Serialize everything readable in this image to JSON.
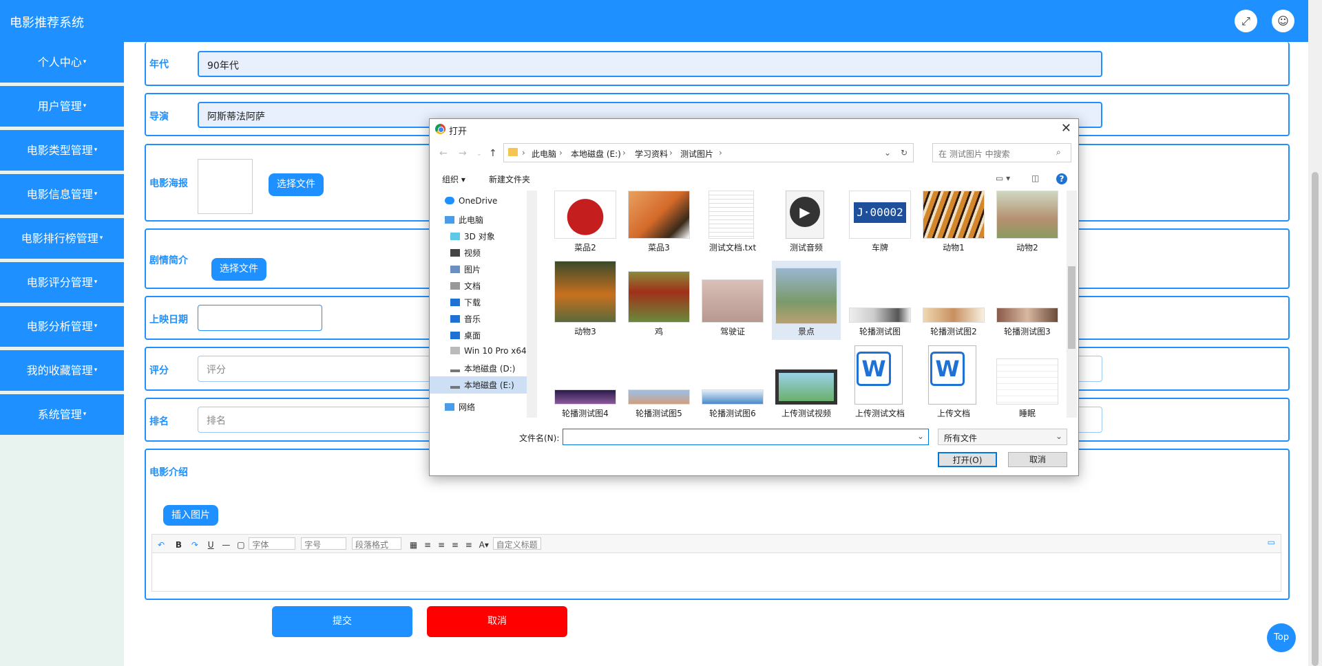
{
  "app": {
    "title": "电影推荐系统",
    "fullscreen_icon": "expand-icon",
    "user_icon": "user-icon",
    "top_button": "Top"
  },
  "sidebar": {
    "items": [
      {
        "label": "个人中心"
      },
      {
        "label": "用户管理"
      },
      {
        "label": "电影类型管理"
      },
      {
        "label": "电影信息管理"
      },
      {
        "label": "电影排行榜管理"
      },
      {
        "label": "电影评分管理"
      },
      {
        "label": "电影分析管理"
      },
      {
        "label": "我的收藏管理"
      },
      {
        "label": "系统管理"
      }
    ],
    "caret": "▾"
  },
  "form": {
    "year_label": "年代",
    "year_value": "90年代",
    "director_label": "导演",
    "director_value": "阿斯蒂法阿萨",
    "poster_label": "电影海报",
    "poster_button": "选择文件",
    "synopsis_label": "剧情简介",
    "synopsis_button": "选择文件",
    "release_label": "上映日期",
    "score_label": "评分",
    "score_placeholder": "评分",
    "rank_label": "排名",
    "rank_placeholder": "排名",
    "intro_label": "电影介绍",
    "insert_image": "插入图片",
    "editor": {
      "font": "字体",
      "size": "字号",
      "paragraph": "段落格式",
      "custom": "自定义标题"
    },
    "submit": "提交",
    "cancel": "取消"
  },
  "dialog": {
    "title": "打开",
    "breadcrumb": [
      "此电脑",
      "本地磁盘 (E:)",
      "学习资料",
      "测试图片"
    ],
    "search_placeholder": "在 测试图片 中搜索",
    "organize": "组织 ▾",
    "new_folder": "新建文件夹",
    "nav": [
      "OneDrive",
      "此电脑",
      "3D 对象",
      "视频",
      "图片",
      "文档",
      "下载",
      "音乐",
      "桌面",
      "Win 10 Pro x64",
      "本地磁盘 (D:)",
      "本地磁盘 (E:)",
      "网络"
    ],
    "files_row1": [
      "菜品2",
      "菜品3",
      "测试文档.txt",
      "测试音频",
      "车牌",
      "动物1",
      "动物2"
    ],
    "files_row2": [
      "动物3",
      "鸡",
      "驾驶证",
      "景点",
      "轮播测试图",
      "轮播测试图2",
      "轮播测试图3"
    ],
    "files_row3": [
      "轮播测试图4",
      "轮播测试图5",
      "轮播测试图6",
      "上传测试视频",
      "上传测试文档",
      "上传文档",
      "睡眠"
    ],
    "plate_text": "J·00002",
    "filename_label": "文件名(N):",
    "filetype": "所有文件",
    "open": "打开(O)",
    "cancel": "取消"
  }
}
